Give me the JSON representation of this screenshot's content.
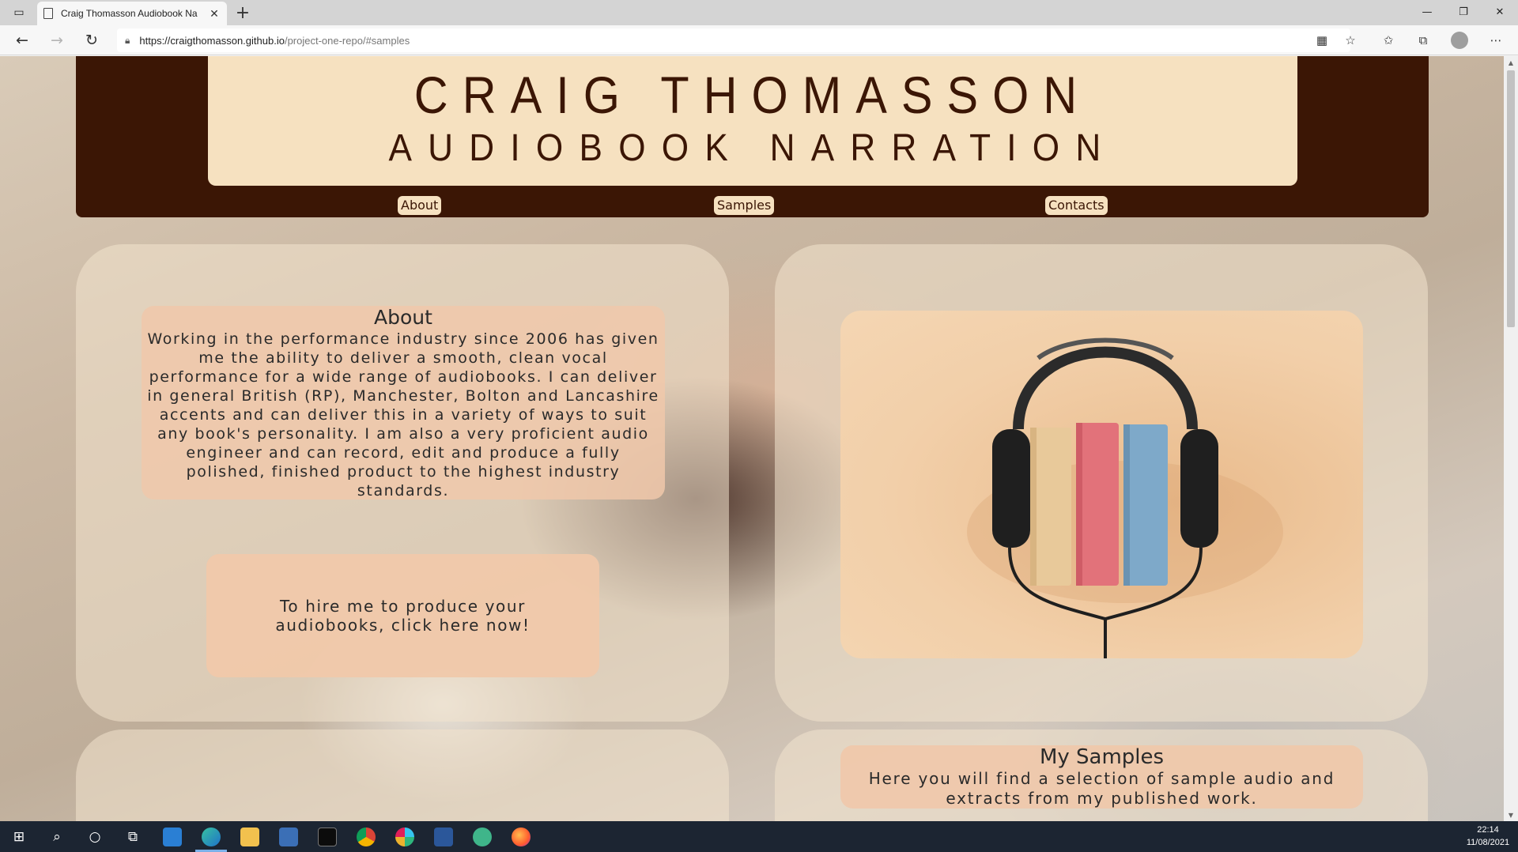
{
  "browser": {
    "tab_title": "Craig Thomasson Audiobook Na",
    "tab_close": "✕",
    "new_tab": "+",
    "url_host": "https://craigthomasson.github.io",
    "url_path": "/project-one-repo/#samples",
    "window_controls": {
      "minimize": "—",
      "maximize": "❐",
      "close": "✕"
    }
  },
  "header": {
    "name": "CRAIG THOMASSON",
    "subtitle": "AUDIOBOOK NARRATION",
    "nav": [
      "About",
      "Samples",
      "Contacts"
    ]
  },
  "about": {
    "title": "About",
    "text": "Working in the performance industry since 2006 has given me the ability to deliver a smooth, clean vocal performance for a wide range of audiobooks. I can deliver in general British (RP), Manchester, Bolton and Lancashire accents and can deliver this in a variety of ways to suit any book's personality. I am also a very proficient audio engineer and can record, edit and produce a fully polished, finished product to the highest industry standards.",
    "cta": "To hire me to produce your audiobooks, click here now!"
  },
  "samples": {
    "title": "My Samples",
    "text": "Here you will find a selection of sample audio and extracts from my published work."
  },
  "taskbar": {
    "time": "22:14",
    "date": "11/08/2021"
  },
  "colors": {
    "header_bg": "#3b1605",
    "header_panel": "#f6e1c0",
    "box_peach": "#f0c8aa"
  }
}
